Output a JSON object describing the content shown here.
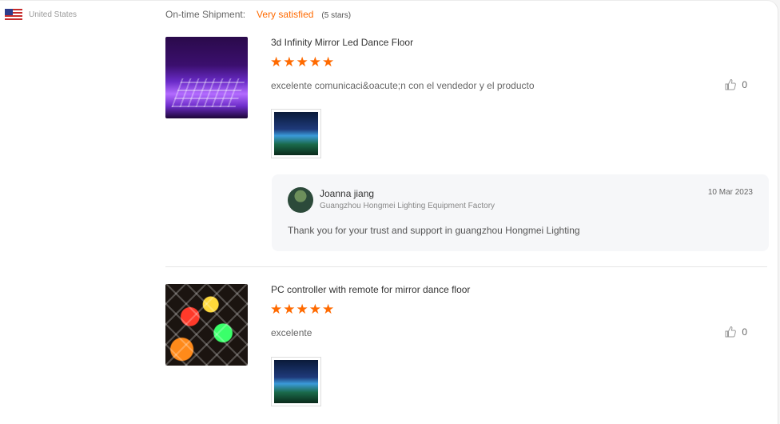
{
  "buyer": {
    "country": "United States"
  },
  "shipment": {
    "label": "On-time Shipment:",
    "value": "Very satisfied",
    "stars_text": "(5 stars)"
  },
  "reviews": [
    {
      "product_title": "3d Infinity Mirror Led Dance Floor",
      "stars": "★★★★★",
      "rating": 5,
      "comment": "excelente comunicaci&oacute;n con el vendedor y el producto",
      "likes": "0",
      "reply": {
        "name": "Joanna jiang",
        "company": "Guangzhou Hongmei Lighting Equipment Factory",
        "date": "10 Mar 2023",
        "text": "Thank you for your trust and support in guangzhou Hongmei Lighting"
      }
    },
    {
      "product_title": "PC controller with remote for mirror dance floor",
      "stars": "★★★★★",
      "rating": 5,
      "comment": "excelente",
      "likes": "0"
    }
  ],
  "icons": {
    "like": "thumbs-up-icon",
    "flag": "us-flag-icon"
  },
  "colors": {
    "accent": "#ff6a00",
    "reply_bg": "#f6f7f9"
  }
}
